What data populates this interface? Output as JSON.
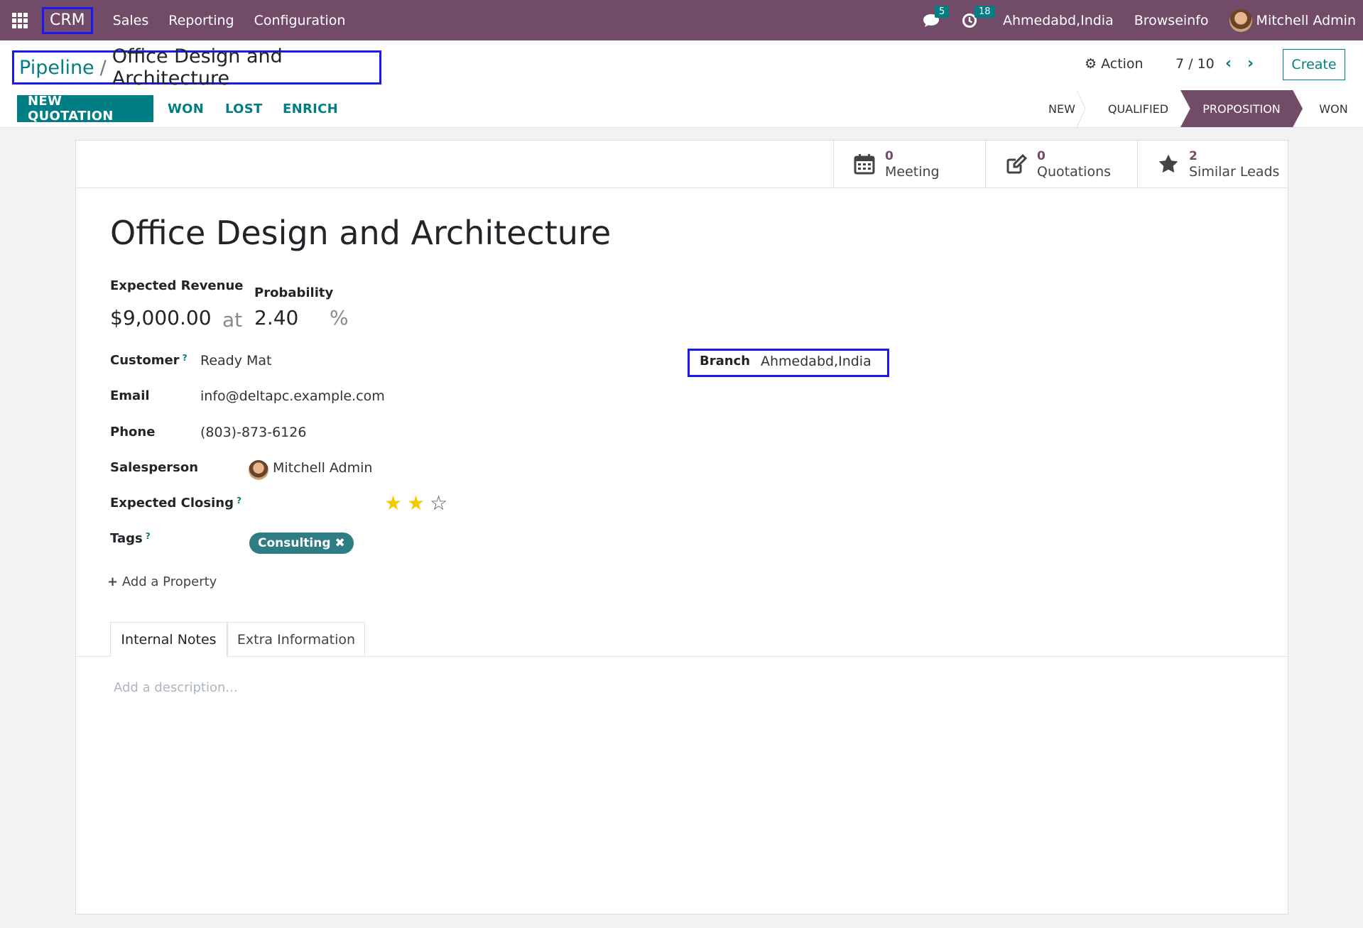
{
  "topbar": {
    "app_name": "CRM",
    "menus": [
      "Sales",
      "Reporting",
      "Configuration"
    ],
    "messages_count": "5",
    "activities_count": "18",
    "branch": "Ahmedabd,India",
    "company": "Browseinfo",
    "user": "Mitchell Admin"
  },
  "control": {
    "breadcrumb_parent": "Pipeline",
    "breadcrumb_sep": "/",
    "breadcrumb_current": "Office Design and Architecture",
    "action_label": "Action",
    "pager": "7 / 10",
    "create_label": "Create"
  },
  "statusbar": {
    "buttons": [
      "NEW QUOTATION",
      "WON",
      "LOST",
      "ENRICH"
    ],
    "stages": [
      "NEW",
      "QUALIFIED",
      "PROPOSITION",
      "WON"
    ],
    "active_stage": "PROPOSITION"
  },
  "smart_buttons": [
    {
      "count": "0",
      "label": "Meeting",
      "icon": "calendar-icon"
    },
    {
      "count": "0",
      "label": "Quotations",
      "icon": "edit-icon"
    },
    {
      "count": "2",
      "label": "Similar Leads",
      "icon": "star-icon"
    }
  ],
  "record": {
    "title": "Office Design and Architecture",
    "expected_revenue_label": "Expected Revenue",
    "expected_revenue": "$9,000.00",
    "at": "at",
    "probability_label": "Probability",
    "probability": "2.40",
    "percent": "%",
    "customer_label": "Customer",
    "customer": "Ready Mat",
    "email_label": "Email",
    "email": "info@deltapc.example.com",
    "phone_label": "Phone",
    "phone": "(803)-873-6126",
    "salesperson_label": "Salesperson",
    "salesperson": "Mitchell Admin",
    "expected_closing_label": "Expected Closing",
    "priority_stars": 2,
    "priority_max": 3,
    "tags_label": "Tags",
    "tag": "Consulting",
    "add_property": "Add a Property",
    "branch_label": "Branch",
    "branch": "Ahmedabd,India",
    "help_mark": "?"
  },
  "tabs": [
    "Internal Notes",
    "Extra Information"
  ],
  "notes_placeholder": "Add a description..."
}
